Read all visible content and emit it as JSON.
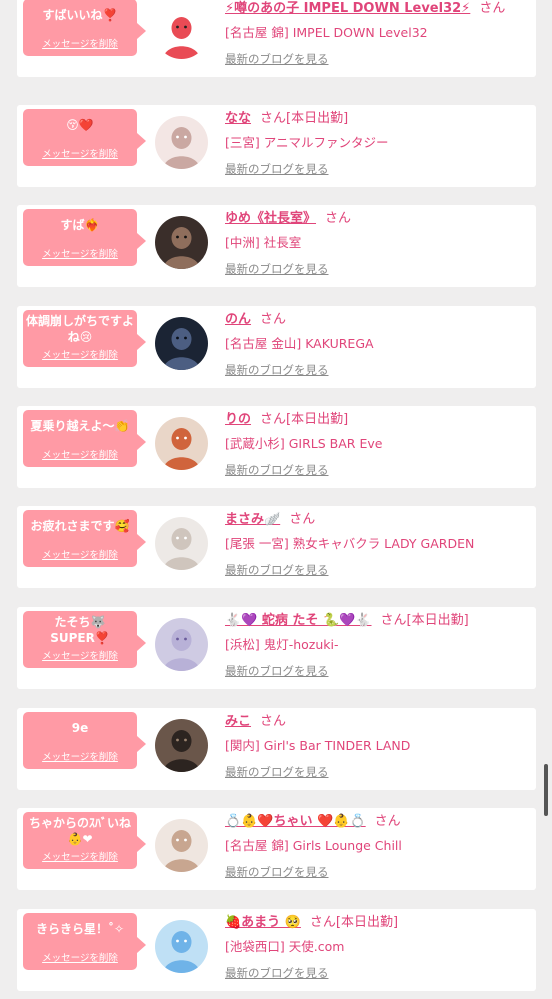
{
  "ui": {
    "delete_label": "メッセージを削除",
    "blog_label": "最新のブログを見る"
  },
  "colors": {
    "page_background": "#efeeee",
    "bubble": "#ff9aa5",
    "name_text": "#e0457a",
    "link_gray": "#8a8a8a"
  },
  "cards": [
    {
      "message": "すばいいね❣️",
      "name": "⚡噂のあの子 IMPEL DOWN Level32⚡",
      "suffix": "さん",
      "badge": "",
      "shop": "[名古屋 錦] IMPEL DOWN Level32",
      "avatar_icon": "police-cartoon-avatar-icon"
    },
    {
      "message": "😚❤️",
      "name": "なな",
      "suffix": "さん",
      "badge": "[本日出勤]",
      "shop": "[三宮] アニマルファンタジー",
      "avatar_icon": "woman-photo-avatar-icon"
    },
    {
      "message": "すば❤️‍🔥",
      "name": "ゆめ《社長室》",
      "suffix": "さん",
      "badge": "",
      "shop": "[中洲] 社長室",
      "avatar_icon": "dark-photo-avatar-icon"
    },
    {
      "message": "体調崩しがちですよね😢",
      "name": "のん",
      "suffix": "さん",
      "badge": "",
      "shop": "[名古屋 金山] KAKUREGA",
      "avatar_icon": "night-photo-avatar-icon"
    },
    {
      "message": "夏乗り越えよ〜👏",
      "name": "りの",
      "suffix": "さん",
      "badge": "[本日出勤]",
      "shop": "[武蔵小杉] GIRLS BAR Eve",
      "avatar_icon": "redhead-photo-avatar-icon"
    },
    {
      "message": "お疲れさまです🥰",
      "name": "まさみ🪽",
      "suffix": "さん",
      "badge": "",
      "shop": "[尾張 一宮] 熟女キャバクラ LADY GARDEN",
      "avatar_icon": "portrait-photo-avatar-icon"
    },
    {
      "message": "たそち🐺\nSUPER❣️",
      "name": "🐇💜 蛇病 たそ 🐍💜🐇",
      "suffix": "さん",
      "badge": "[本日出勤]",
      "shop": "[浜松] 鬼灯-hozuki-",
      "avatar_icon": "silver-hair-avatar-icon"
    },
    {
      "message": "9e",
      "name": "みこ",
      "suffix": "さん",
      "badge": "",
      "shop": "[関内] Girl's Bar TINDER LAND",
      "avatar_icon": "brown-photo-avatar-icon"
    },
    {
      "message": "ちゃからのｽﾊﾞいね👶❤",
      "name": "💍👶❤️ちゃい ❤️👶💍",
      "suffix": "さん",
      "badge": "",
      "shop": "[名古屋 錦] Girls Lounge Chill",
      "avatar_icon": "plush-toy-avatar-icon"
    },
    {
      "message": "きらきら星！˚✧",
      "name": "🍓あまう 🥺",
      "suffix": "さん",
      "badge": "[本日出勤]",
      "shop": "[池袋西口] 天使.com",
      "avatar_icon": "blue-hair-avatar-icon"
    }
  ]
}
